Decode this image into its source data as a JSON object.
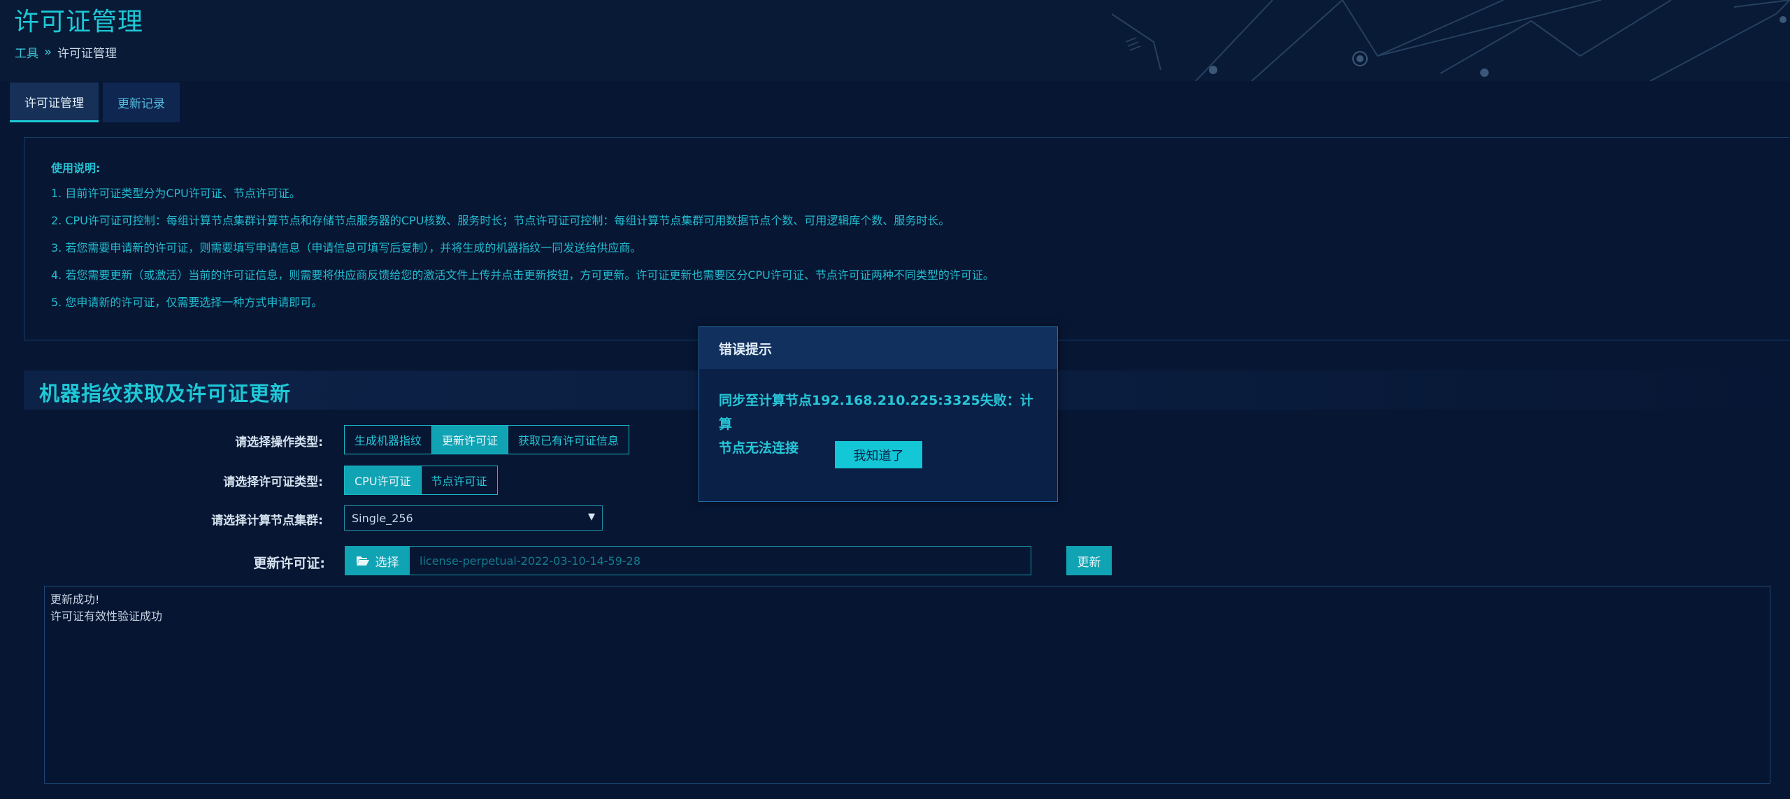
{
  "page": {
    "title": "许可证管理",
    "breadcrumb": {
      "parent": "工具",
      "separator": "»",
      "current": "许可证管理"
    }
  },
  "tabs": [
    {
      "label": "许可证管理",
      "active": true
    },
    {
      "label": "更新记录",
      "active": false
    }
  ],
  "instructions": {
    "heading": "使用说明:",
    "lines": [
      "1. 目前许可证类型分为CPU许可证、节点许可证。",
      "2. CPU许可证可控制：每组计算节点集群计算节点和存储节点服务器的CPU核数、服务时长；节点许可证可控制：每组计算节点集群可用数据节点个数、可用逻辑库个数、服务时长。",
      "3. 若您需要申请新的许可证，则需要填写申请信息（申请信息可填写后复制），并将生成的机器指纹一同发送给供应商。",
      "4. 若您需要更新（或激活）当前的许可证信息，则需要将供应商反馈给您的激活文件上传并点击更新按钮，方可更新。许可证更新也需要区分CPU许可证、节点许可证两种不同类型的许可证。",
      "5. 您申请新的许可证，仅需要选择一种方式申请即可。"
    ]
  },
  "section": {
    "title": "机器指纹获取及许可证更新"
  },
  "form": {
    "operation_type": {
      "label": "请选择操作类型:",
      "options": [
        "生成机器指纹",
        "更新许可证",
        "获取已有许可证信息"
      ],
      "selected": "更新许可证"
    },
    "license_type": {
      "label": "请选择许可证类型:",
      "options": [
        "CPU许可证",
        "节点许可证"
      ],
      "selected": "CPU许可证"
    },
    "cluster": {
      "label": "请选择计算节点集群:",
      "value": "Single_256"
    },
    "update_license": {
      "label": "更新许可证:",
      "choose_label": "选择",
      "file_name": "license-perpetual-2022-03-10-14-59-28",
      "update_button": "更新"
    },
    "output_lines": [
      "更新成功!",
      "许可证有效性验证成功"
    ]
  },
  "modal": {
    "title": "错误提示",
    "message_line1": "同步至计算节点192.168.210.225:3325失败：计算",
    "message_line2": "节点无法连接",
    "ok_button": "我知道了"
  },
  "icons": {
    "file_button": "folder-open-icon",
    "select_caret": "caret-down-icon"
  },
  "colors": {
    "accent": "#1ec8d6",
    "button_bg": "#10a3b3",
    "background": "#071633"
  }
}
